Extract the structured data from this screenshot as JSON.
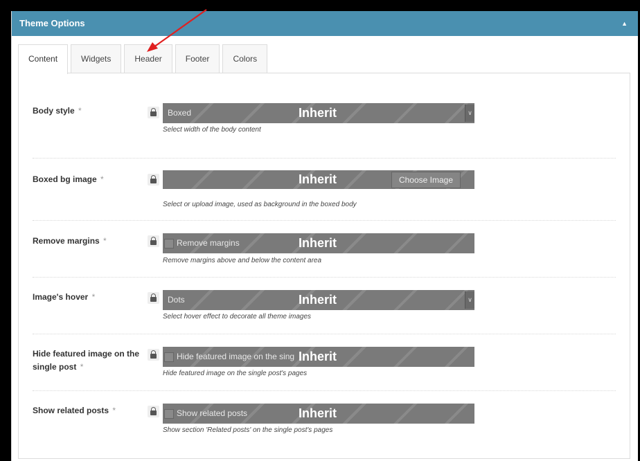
{
  "panel": {
    "title": "Theme Options"
  },
  "tabs": [
    {
      "label": "Content",
      "active": true
    },
    {
      "label": "Widgets"
    },
    {
      "label": "Header"
    },
    {
      "label": "Footer"
    },
    {
      "label": "Colors"
    }
  ],
  "inherit_label": "Inherit",
  "options": {
    "body_style": {
      "label": "Body style",
      "star": "*",
      "value": "Boxed",
      "desc": "Select width of the body content"
    },
    "boxed_bg_image": {
      "label": "Boxed bg image",
      "star": "*",
      "button": "Choose Image",
      "desc": "Select or upload image, used as background in the boxed body"
    },
    "remove_margins": {
      "label": "Remove margins",
      "star": "*",
      "checkbox_label": "Remove margins",
      "desc": "Remove margins above and below the content area"
    },
    "image_hover": {
      "label": "Image's hover",
      "star": "*",
      "value": "Dots",
      "desc": "Select hover effect to decorate all theme images"
    },
    "hide_featured": {
      "label": "Hide featured image on the single post",
      "star": "*",
      "checkbox_label": "Hide featured image on the sing",
      "desc": "Hide featured image on the single post's pages"
    },
    "related_posts": {
      "label": "Show related posts",
      "star": "*",
      "checkbox_label": "Show related posts",
      "desc": "Show section 'Related posts' on the single post's pages"
    }
  },
  "colors": {
    "header_bg": "#4a90b0",
    "control_bg": "#7a7a7a",
    "arrow": "#e02020"
  },
  "icons": {
    "collapse": "caret-up-icon",
    "lock": "lock-icon",
    "select": "chevron-down-icon"
  }
}
